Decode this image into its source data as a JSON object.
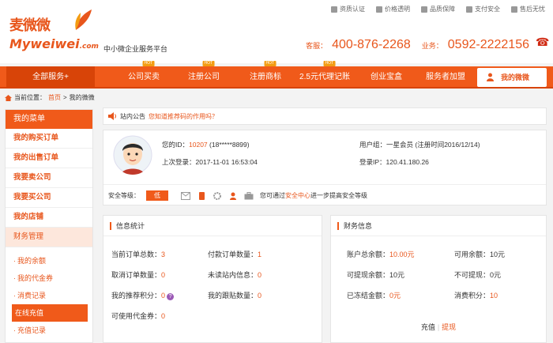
{
  "logo": {
    "cn": "麦微微",
    "en": "Myweiwei",
    "dotcom": ".com"
  },
  "slogan": "中小微企业服务平台",
  "utility": [
    {
      "icon": "certificate-icon",
      "label": "资质认证"
    },
    {
      "icon": "price-tag-icon",
      "label": "价格透明"
    },
    {
      "icon": "shield-icon",
      "label": "品质保障"
    },
    {
      "icon": "card-icon",
      "label": "支付安全"
    },
    {
      "icon": "thumb-up-icon",
      "label": "售后无忧"
    }
  ],
  "hotline": {
    "label1": "客服：",
    "num1": "400-876-2268",
    "label2": "业务：",
    "num2": "0592-2222156"
  },
  "nav": {
    "all": "全部服务+",
    "items": [
      {
        "label": "公司买卖",
        "hot": "HOT"
      },
      {
        "label": "注册公司",
        "hot": "HOT"
      },
      {
        "label": "注册商标",
        "hot": "HOT"
      },
      {
        "label": "2.5元代理记账",
        "hot": "HOT"
      },
      {
        "label": "创业宝盒",
        "hot": ""
      },
      {
        "label": "服务者加盟",
        "hot": ""
      }
    ],
    "mine": "我的微微"
  },
  "breadcrumb": {
    "prefix": "当前位置：",
    "home": "首页",
    "sep": ">",
    "current": "我的微微"
  },
  "sidebar": {
    "head": "我的菜单",
    "items": [
      "我的购买订单",
      "我的出售订单",
      "我要卖公司",
      "我要买公司",
      "我的店铺"
    ],
    "group": "财务管理",
    "subs": [
      "我的余额",
      "我的代金券",
      "消费记录",
      "在线充值",
      "充值记录"
    ]
  },
  "notice": {
    "title": "站内公告",
    "msg": "您知道推荐码的作用吗？"
  },
  "profile": {
    "id_label": "您的ID：",
    "id": "10207",
    "phone": "(18*****8899)",
    "group_label": "用户组：",
    "group": "一星会员 (注册时间2016/12/14)",
    "last_login_label": "上次登录：",
    "last_login": "2017-11-01 16:53:04",
    "ip_label": "登录IP：",
    "ip": "120.41.180.26",
    "security_label": "安全等级：",
    "security_level": "低",
    "security_tip_a": "您可通过",
    "security_tip_link": "安全中心",
    "security_tip_b": "进一步提高安全等级"
  },
  "stats": {
    "title": "信息统计",
    "items": [
      {
        "label": "当前订单总数：",
        "value": "3"
      },
      {
        "label": "付款订单数量：",
        "value": "1"
      },
      {
        "label": "取消订单数量：",
        "value": "0"
      },
      {
        "label": "未读站内信息：",
        "value": "0"
      },
      {
        "label": "我的推荐积分：",
        "value": "0"
      },
      {
        "label": "我的跟贴数量：",
        "value": "0"
      },
      {
        "label": "可使用代金券：",
        "value": "0"
      }
    ],
    "help_glyph": "?"
  },
  "finance": {
    "title": "财务信息",
    "items": [
      {
        "label": "账户总余额：",
        "value": "10.00元"
      },
      {
        "label": "可用余额：",
        "value": "10元"
      },
      {
        "label": "可提现余额：",
        "value": "10元"
      },
      {
        "label": "不可提现：",
        "value": "0元"
      },
      {
        "label": "已冻结金额：",
        "value": "0元"
      },
      {
        "label": "消费积分：",
        "value": "10"
      }
    ],
    "recharge": "充值",
    "sep": "|",
    "withdraw": "提现"
  },
  "colors": {
    "accent": "#f05a1a",
    "accent_dark": "#d84408",
    "text": "#333333"
  }
}
